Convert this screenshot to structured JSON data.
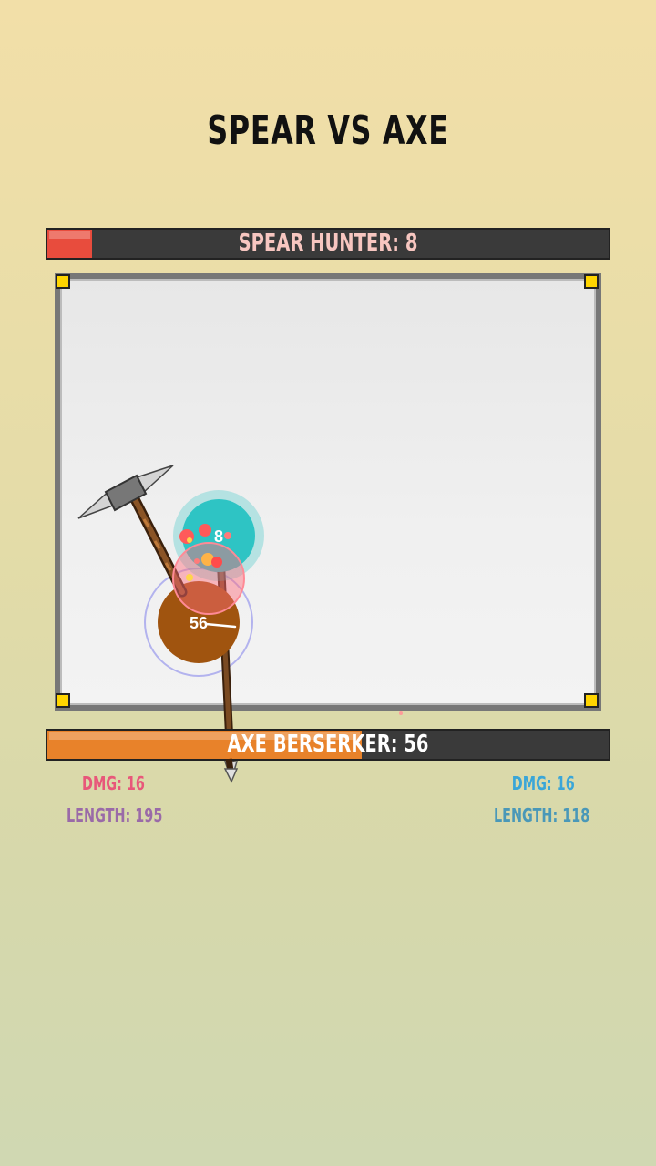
{
  "title": "SPEAR VS AXE",
  "spear_hunter": {
    "label": "SPEAR HUNTER: 8",
    "hp": 8,
    "hp_fraction": 0.08,
    "bar_color": "#e84c3d",
    "label_color": "#f7c6c0"
  },
  "axe_berserker": {
    "label": "AXE BERSERKER: 56",
    "hp": 56,
    "hp_fraction": 0.56,
    "bar_color": "#e8822a",
    "label_color": "#ffffff"
  },
  "arena": {
    "spear_ball_label": "8",
    "axe_ball_label": "56",
    "spear_ball_color": "#2ec4c4",
    "axe_ball_color": "#a0540f"
  },
  "stats": {
    "left": {
      "dmg": "DMG: 16",
      "length": "LENGTH: 195"
    },
    "right": {
      "dmg": "DMG: 16",
      "length": "LENGTH: 118"
    }
  }
}
